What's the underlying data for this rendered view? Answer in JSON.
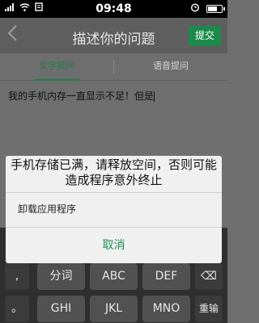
{
  "status_bar": {
    "time": "09:48"
  },
  "header": {
    "title": "描述你的问题",
    "submit_label": "提交"
  },
  "tabs": [
    {
      "label": "文字提问"
    },
    {
      "label": "语音提问"
    }
  ],
  "question": {
    "text": "我的手机内存一直显示不足！但是"
  },
  "dialog": {
    "message": "手机存储已满，请释放空间，否则可能造成程序意外终止",
    "option": "卸载应用程序",
    "cancel": "取消"
  },
  "keyboard": {
    "row1": [
      ",",
      "分词",
      "ABC",
      "DEF",
      "⌫"
    ],
    "row2": [
      "。",
      "GHI",
      "JKL",
      "MNO",
      "重输"
    ]
  },
  "colors": {
    "accent": "#1f8e50",
    "submit_bg": "#1c8a4c"
  }
}
